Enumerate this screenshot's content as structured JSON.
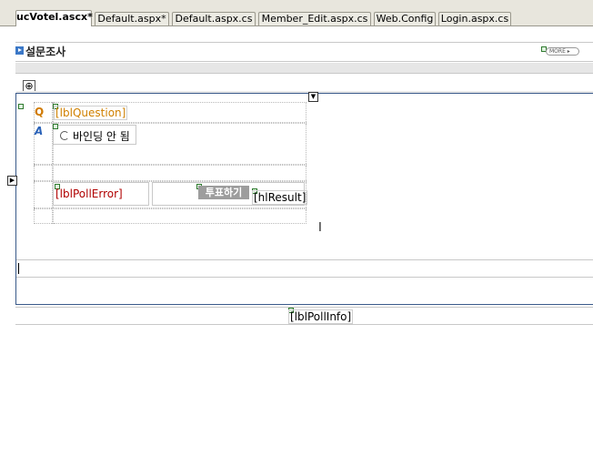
{
  "tabs": [
    {
      "label": "ucVotel.ascx*",
      "active": true
    },
    {
      "label": "Default.aspx*",
      "active": false
    },
    {
      "label": "Default.aspx.cs",
      "active": false
    },
    {
      "label": "Member_Edit.aspx.cs",
      "active": false
    },
    {
      "label": "Web.Config",
      "active": false
    },
    {
      "label": "Login.aspx.cs",
      "active": false
    }
  ],
  "header": {
    "title": "설문조사",
    "more_label": "MORE ▸"
  },
  "poll": {
    "q_mark": "Q",
    "a_mark": "A",
    "question_label": "[lblQuestion]",
    "radio_label": "바인딩 안 됨",
    "error_label": "[lblPollError]",
    "vote_button": "투표하기",
    "result_label": "[hlResult]"
  },
  "footer": {
    "info_label": "[lblPollInfo]"
  },
  "icons": {
    "move_handle": "⊕",
    "dropdown": "▼",
    "left_arrow": "▶",
    "ibeam": "I"
  },
  "colors": {
    "question_label": "#d08000",
    "error_label": "#b00000",
    "panel_border": "#3a5a8a",
    "vote_button_bg": "#9d9d9d"
  }
}
